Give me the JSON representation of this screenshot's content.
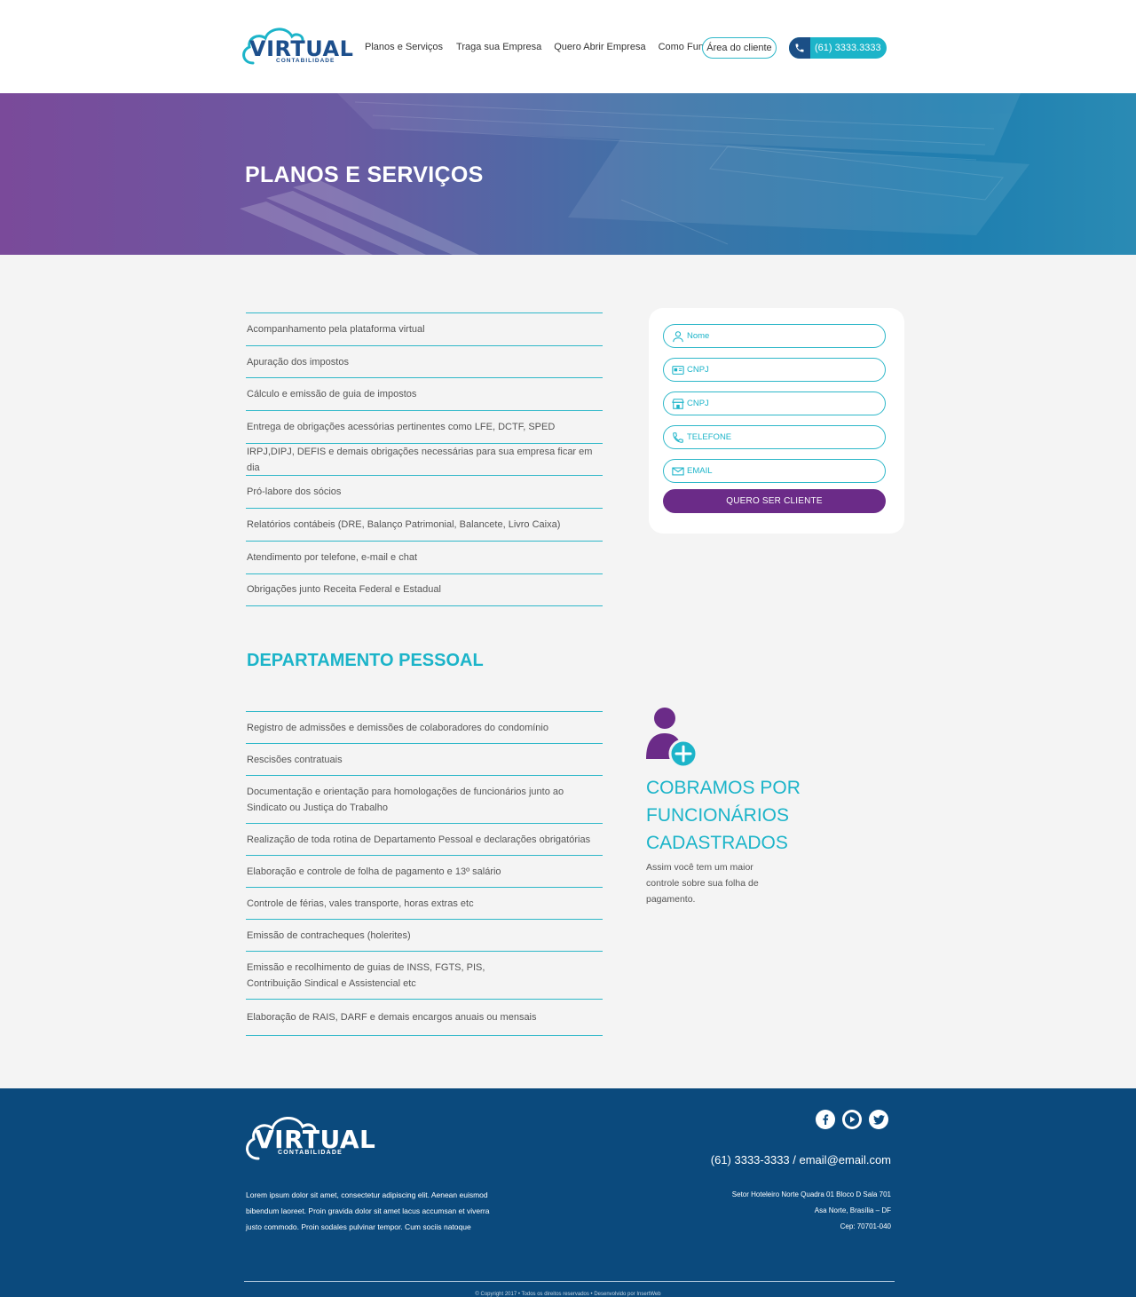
{
  "header": {
    "logo_text": "VIRTUAL",
    "logo_sub": "CONTABILIDADE",
    "nav": [
      "Planos e Serviços",
      "Traga sua Empresa",
      "Quero Abrir Empresa",
      "Como Funciona"
    ],
    "client_area_label": "Área do cliente",
    "phone_label": "(61) 3333.3333"
  },
  "hero": {
    "title": "PLANOS E SERVIÇOS"
  },
  "services": [
    "Acompanhamento pela plataforma virtual",
    "Apuração dos impostos",
    "Cálculo e emissão de guia de impostos",
    "Entrega de obrigações acessórias pertinentes como LFE, DCTF, SPED",
    "IRPJ,DIPJ, DEFIS e demais obrigações necessárias para sua empresa ficar em dia",
    "Pró-labore dos sócios",
    "Relatórios contábeis (DRE, Balanço Patrimonial, Balancete, Livro Caixa)",
    "Atendimento por telefone, e-mail e chat",
    "Obrigações junto Receita Federal e Estadual"
  ],
  "form": {
    "fields": [
      {
        "label": "Nome",
        "icon": "user-icon"
      },
      {
        "label": "CNPJ",
        "icon": "id-card-icon"
      },
      {
        "label": "CNPJ",
        "icon": "store-icon"
      },
      {
        "label": "TELEFONE",
        "icon": "phone-icon"
      },
      {
        "label": "EMAIL",
        "icon": "mail-icon"
      }
    ],
    "submit_label": "QUERO SER CLIENTE"
  },
  "dept": {
    "title": "DEPARTAMENTO PESSOAL",
    "items": [
      "Registro de admissões e demissões de colaboradores do condomínio",
      "Rescisões contratuais",
      "Documentação e orientação para homologações de funcionários junto ao Sindicato ou Justiça do Trabalho",
      "Realização de toda rotina de Departamento Pessoal e declarações obrigatórias",
      "Elaboração e controle de folha de pagamento e 13º salário",
      "Controle de férias, vales transporte, horas extras etc",
      "Emissão de contracheques (holerites)",
      "Emissão e recolhimento de guias de INSS, FGTS, PIS, Contribuição Sindical e Assistencial etc",
      "Elaboração de RAIS, DARF e demais encargos anuais ou mensais"
    ]
  },
  "promo": {
    "title": "COBRAMOS POR FUNCIONÁRIOS CADASTRADOS",
    "text": "Assim você tem um maior controle sobre sua folha de pagamento."
  },
  "footer": {
    "logo_text": "VIRTUAL",
    "logo_sub": "CONTABILIDADE",
    "about": "Lorem ipsum dolor sit amet, consectetur adipiscing elit. Aenean euismod bibendum laoreet. Proin gravida dolor sit amet lacus accumsan et viverra justo commodo. Proin sodales pulvinar tempor. Cum sociis natoque",
    "contact": "(61) 3333-3333  /  email@email.com",
    "address": [
      "Setor Hoteleiro Norte Quadra 01 Bloco D Sala 701",
      "Asa Norte, Brasília – DF",
      "Cep: 70701-040"
    ],
    "copyright": "© Copyright 2017 • Todos os direitos reservados • Desenvolvido por InsertWeb",
    "socials": [
      "facebook-icon",
      "youtube-icon",
      "twitter-icon"
    ]
  },
  "colors": {
    "accent": "#1cb4c9",
    "brand": "#1d4f8c",
    "purple": "#6b2b88",
    "footer": "#0b4a7d"
  }
}
